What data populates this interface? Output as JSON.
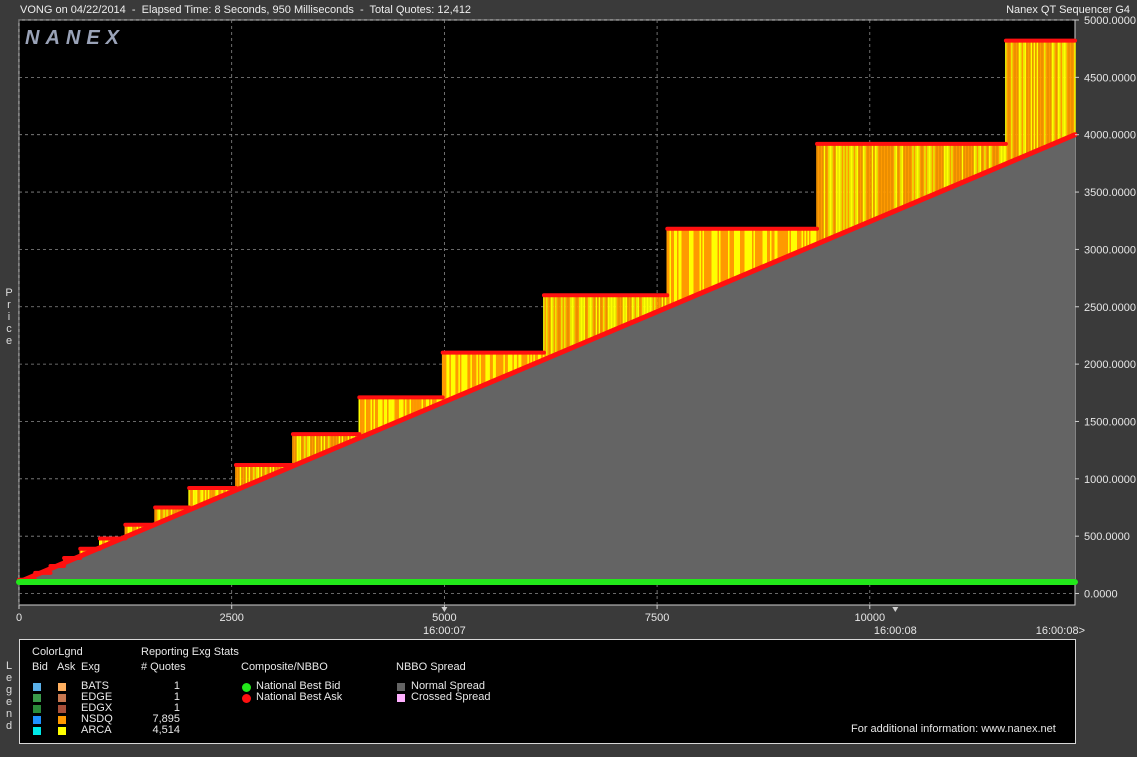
{
  "header": {
    "left_text": "VONG on 04/22/2014  -  Elapsed Time: 8 Seconds, 950 Milliseconds  -  Total Quotes: 12,412",
    "right_text": "Nanex QT Sequencer G4"
  },
  "watermark": "NANEX",
  "y_axis_title": "Price",
  "legend_title": "Legend",
  "colors": {
    "background": "#000000",
    "frame": "#3a3a3a",
    "spread_fill": "#646464",
    "bid_line": "#22e81a",
    "ask_line": "#ff1010",
    "quote_orange": "#ff9a00",
    "quote_yellow": "#ffff00"
  },
  "chart_data": {
    "type": "line",
    "title": "",
    "xlabel": "",
    "ylabel": "Price",
    "x_range": [
      0,
      12412
    ],
    "y_range": [
      -100,
      5000
    ],
    "x_ticks": [
      0,
      2500,
      5000,
      7500,
      10000
    ],
    "x_tick_labels": [
      "0",
      "2500",
      "5000",
      "7500",
      "10000"
    ],
    "time_ticks": [
      {
        "x": 5000,
        "label": "16:00:07"
      },
      {
        "x": 10300,
        "label": "16:00:08"
      },
      {
        "x": 12412,
        "label": "16:00:08>"
      }
    ],
    "y_ticks": [
      0,
      500,
      1000,
      1500,
      2000,
      2500,
      3000,
      3500,
      4000,
      4500,
      5000
    ],
    "y_tick_labels": [
      "0.0000",
      "500.0000",
      "1000.0000",
      "1500.0000",
      "2000.0000",
      "2500.0000",
      "3000.0000",
      "3500.0000",
      "4000.0000",
      "4500.0000",
      "5000.0000"
    ],
    "grid": true,
    "series": [
      {
        "name": "National Best Bid",
        "values": [
          [
            0,
            100
          ],
          [
            12412,
            100
          ]
        ]
      },
      {
        "name": "National Best Ask",
        "values": [
          [
            0,
            100
          ],
          [
            12412,
            4000
          ]
        ]
      },
      {
        "name": "ARCA",
        "steps": [
          [
            0,
            190,
            120
          ],
          [
            190,
            370,
            180
          ],
          [
            370,
            530,
            240
          ],
          [
            530,
            720,
            310
          ],
          [
            720,
            950,
            390
          ],
          [
            950,
            1250,
            480
          ],
          [
            1250,
            1600,
            600
          ],
          [
            1600,
            2000,
            750
          ],
          [
            2000,
            2550,
            920
          ],
          [
            2550,
            3220,
            1120
          ],
          [
            3220,
            4000,
            1390
          ],
          [
            4000,
            4980,
            1710
          ],
          [
            4980,
            6170,
            2100
          ],
          [
            6170,
            7620,
            2600
          ],
          [
            7620,
            9380,
            3180
          ],
          [
            9380,
            11600,
            3920
          ],
          [
            11600,
            12412,
            4820
          ]
        ]
      }
    ]
  },
  "legend": {
    "headers": {
      "color_legend": "ColorLgnd",
      "bid": "Bid",
      "ask": "Ask",
      "exg": "Exg",
      "reporting": "Reporting Exg Stats",
      "quotes": "# Quotes",
      "composite": "Composite/NBBO",
      "spread": "NBBO Spread"
    },
    "exchanges": [
      {
        "name": "BATS",
        "bid_color": "#5ab0e8",
        "ask_color": "#ffb060",
        "quotes": "1"
      },
      {
        "name": "EDGE",
        "bid_color": "#3a9a4a",
        "ask_color": "#c87850",
        "quotes": "1"
      },
      {
        "name": "EDGX",
        "bid_color": "#2a8a3a",
        "ask_color": "#a8503a",
        "quotes": "1"
      },
      {
        "name": "NSDQ",
        "bid_color": "#1e90ff",
        "ask_color": "#ff9a00",
        "quotes": "7,895"
      },
      {
        "name": "ARCA",
        "bid_color": "#00e8e8",
        "ask_color": "#ffff00",
        "quotes": "4,514"
      }
    ],
    "composite": [
      {
        "label": "National Best Bid",
        "color": "#22e81a"
      },
      {
        "label": "National Best Ask",
        "color": "#ff1010"
      }
    ],
    "spread": [
      {
        "label": "Normal Spread",
        "color": "#646464"
      },
      {
        "label": "Crossed Spread",
        "color": "#ffb0ff"
      }
    ],
    "info": "For additional information: www.nanex.net"
  }
}
